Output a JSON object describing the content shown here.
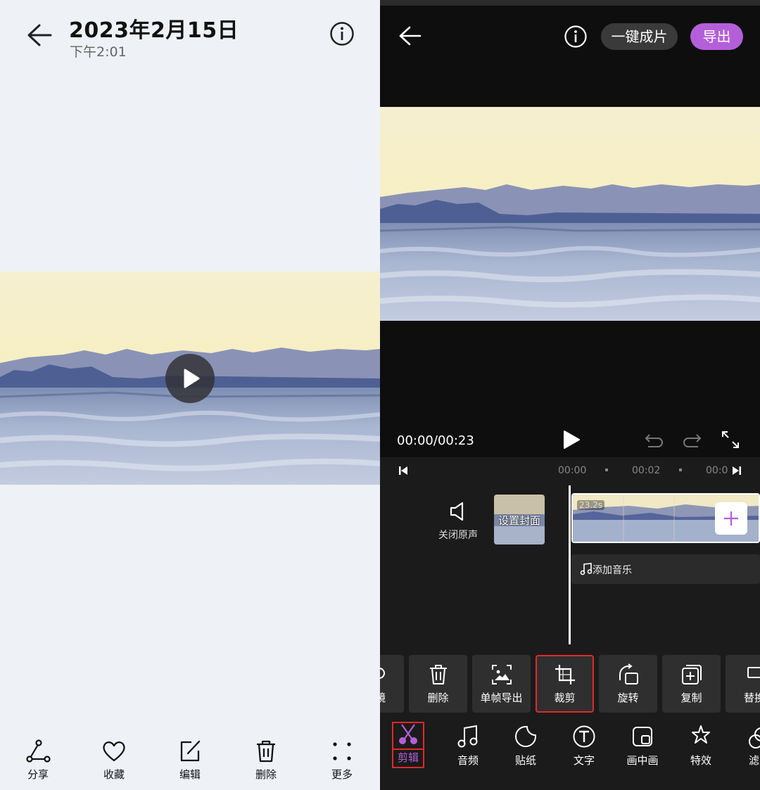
{
  "gallery": {
    "title": "2023年2月15日",
    "subtitle": "下午2:01",
    "actions": [
      {
        "label": "分享",
        "icon": "share-icon"
      },
      {
        "label": "收藏",
        "icon": "heart-icon"
      },
      {
        "label": "编辑",
        "icon": "edit-icon"
      },
      {
        "label": "删除",
        "icon": "trash-icon"
      },
      {
        "label": "更多",
        "icon": "more-icon"
      }
    ]
  },
  "editor": {
    "one_click_label": "一键成片",
    "export_label": "导出",
    "timecode": "00:00/00:23",
    "ruler_ticks": [
      "00:00",
      "00:02",
      "00:0"
    ],
    "mute_label": "关闭原声",
    "cover_label": "设置封面",
    "clip_duration": "23.2s",
    "music_label": "添加音乐",
    "tools": [
      {
        "label": "镜",
        "icon": "mirror-icon"
      },
      {
        "label": "删除",
        "icon": "trash-icon"
      },
      {
        "label": "单帧导出",
        "icon": "frame-export-icon"
      },
      {
        "label": "裁剪",
        "icon": "crop-icon"
      },
      {
        "label": "旋转",
        "icon": "rotate-icon"
      },
      {
        "label": "复制",
        "icon": "copy-icon"
      },
      {
        "label": "替换",
        "icon": "replace-icon"
      }
    ],
    "tabs": [
      {
        "label": "剪辑",
        "icon": "scissors-icon",
        "active": true
      },
      {
        "label": "音频",
        "icon": "music-note-icon"
      },
      {
        "label": "贴纸",
        "icon": "sticker-icon"
      },
      {
        "label": "文字",
        "icon": "text-icon"
      },
      {
        "label": "画中画",
        "icon": "picture-in-picture-icon"
      },
      {
        "label": "特效",
        "icon": "effects-icon"
      },
      {
        "label": "滤",
        "icon": "filter-icon"
      }
    ]
  },
  "colors": {
    "accent": "#b45fd9",
    "highlight": "#e02a2a"
  }
}
